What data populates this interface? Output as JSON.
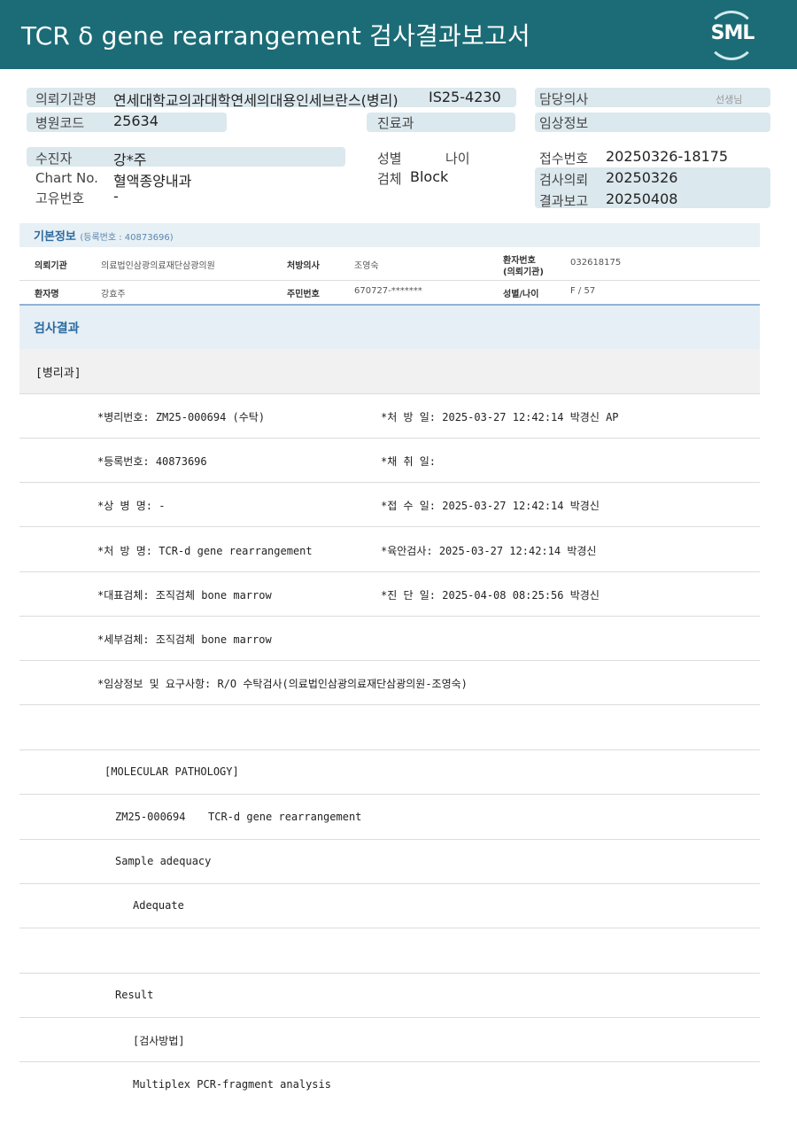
{
  "header": {
    "title": "TCR δ gene rearrangement 검사결과보고서",
    "logo_text": "SML"
  },
  "info": {
    "req_institution_label": "의뢰기관명",
    "req_institution_value": "연세대학교의과대학연세의대용인세브란스(병리)",
    "req_institution_code": "IS25-4230",
    "doctor_label": "담당의사",
    "doctor_suffix": "선생님",
    "hospital_code_label": "병원코드",
    "hospital_code_value": "25634",
    "dept_label": "진료과",
    "clinical_info_label": "임상정보",
    "patient_label": "수진자",
    "patient_value": "강*주",
    "sex_label": "성별",
    "age_label": "나이",
    "receipt_no_label": "접수번호",
    "receipt_no_value": "20250326-18175",
    "chart_no_label": "Chart No.",
    "chart_no_value": "혈액종양내과",
    "specimen_label": "검체",
    "specimen_value": "Block",
    "test_request_label": "검사의뢰",
    "test_request_value": "20250326",
    "unique_no_label": "고유번호",
    "unique_no_value": "-",
    "result_report_label": "결과보고",
    "result_report_value": "20250408"
  },
  "basic": {
    "title": "기본정보",
    "reg_no_note": "(등록번호 : 40873696)",
    "inst_label": "의뢰기관",
    "inst_value": "의료법인삼광의료재단삼광의원",
    "prescriber_label": "처방의사",
    "prescriber_value": "조영숙",
    "patient_no_label_1": "환자번호",
    "patient_no_label_2": "(의뢰기관)",
    "patient_no_value": "032618175",
    "patient_name_label": "환자명",
    "patient_name_value": "강효주",
    "resident_no_label": "주민번호",
    "resident_no_value": "670727-*******",
    "sex_age_label": "성별/나이",
    "sex_age_value": "F / 57"
  },
  "results": {
    "section_title": "검사결과",
    "dept_title": "[병리과]",
    "rows": [
      {
        "left": "*병리번호: ZM25-000694 (수탁)",
        "right": "*처 방 일: 2025-03-27 12:42:14  박경신 AP"
      },
      {
        "left": "*등록번호: 40873696",
        "right": "*채 취 일:"
      },
      {
        "left": "*상 병 명: -",
        "right": "*접 수 일: 2025-03-27 12:42:14  박경신"
      },
      {
        "left": "*처 방 명: TCR-d gene rearrangement",
        "right": "*육안검사: 2025-03-27 12:42:14  박경신"
      },
      {
        "left": "*대표검체: 조직검체 bone marrow",
        "right": "*진 단 일: 2025-04-08 08:25:56  박경신"
      },
      {
        "left": "*세부검체: 조직검체 bone marrow",
        "right": ""
      },
      {
        "left": "*임상정보 및 요구사항: R/O 수탁검사(의료법인삼광의료재단삼광의원-조영숙)",
        "right": ""
      }
    ],
    "molecular_title": "[MOLECULAR PATHOLOGY]",
    "path_no": "ZM25-000694",
    "test_name": "TCR-d gene rearrangement",
    "sample_adequacy_label": "Sample adequacy",
    "sample_adequacy_value": "Adequate",
    "result_label": "Result",
    "method_label": "[검사방법]",
    "method_value": "Multiplex PCR-fragment analysis"
  },
  "colors": {
    "header_bg": "#1b6c76",
    "pill_bg": "#dbe8ee",
    "section_title": "#2b6aa1"
  }
}
